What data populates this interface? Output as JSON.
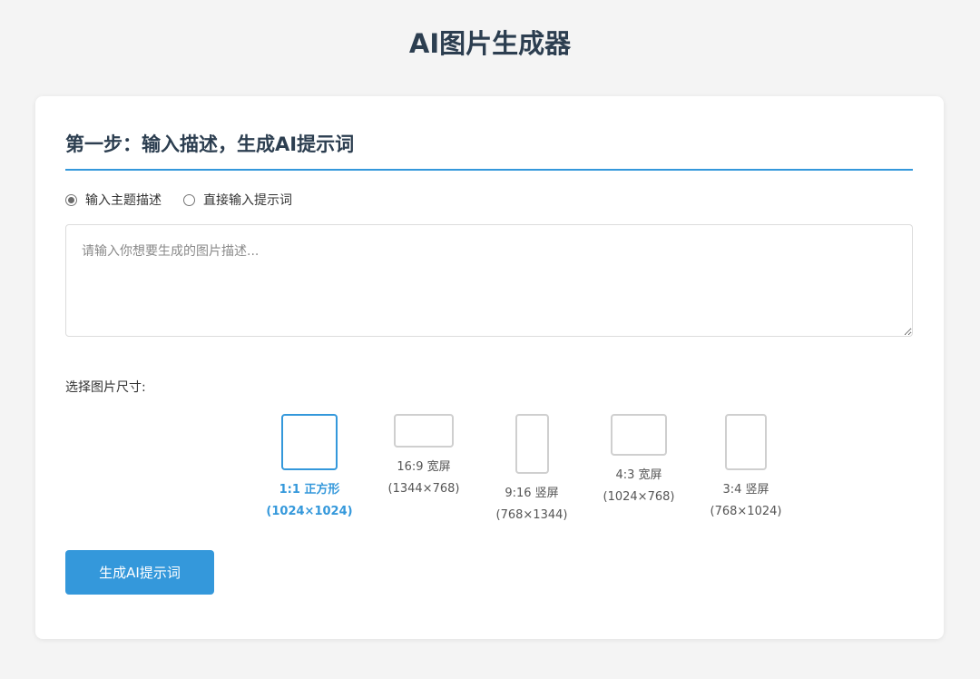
{
  "page": {
    "title": "AI图片生成器"
  },
  "step1": {
    "title": "第一步：输入描述，生成AI提示词",
    "modes": [
      {
        "label": "输入主题描述",
        "checked": true
      },
      {
        "label": "直接输入提示词",
        "checked": false
      }
    ],
    "description": {
      "value": "",
      "placeholder": "请输入你想要生成的图片描述..."
    },
    "size_label": "选择图片尺寸:",
    "sizes": [
      {
        "ratio": "1:1 正方形",
        "resolution": "(1024×1024)",
        "selected": true
      },
      {
        "ratio": "16:9 宽屏",
        "resolution": "(1344×768)",
        "selected": false
      },
      {
        "ratio": "9:16 竖屏",
        "resolution": "(768×1344)",
        "selected": false
      },
      {
        "ratio": "4:3 宽屏",
        "resolution": "(1024×768)",
        "selected": false
      },
      {
        "ratio": "3:4 竖屏",
        "resolution": "(768×1024)",
        "selected": false
      }
    ],
    "generate_label": "生成AI提示词"
  },
  "colors": {
    "accent": "#3498db",
    "title": "#2c3e50",
    "background": "#f4f4f4"
  }
}
